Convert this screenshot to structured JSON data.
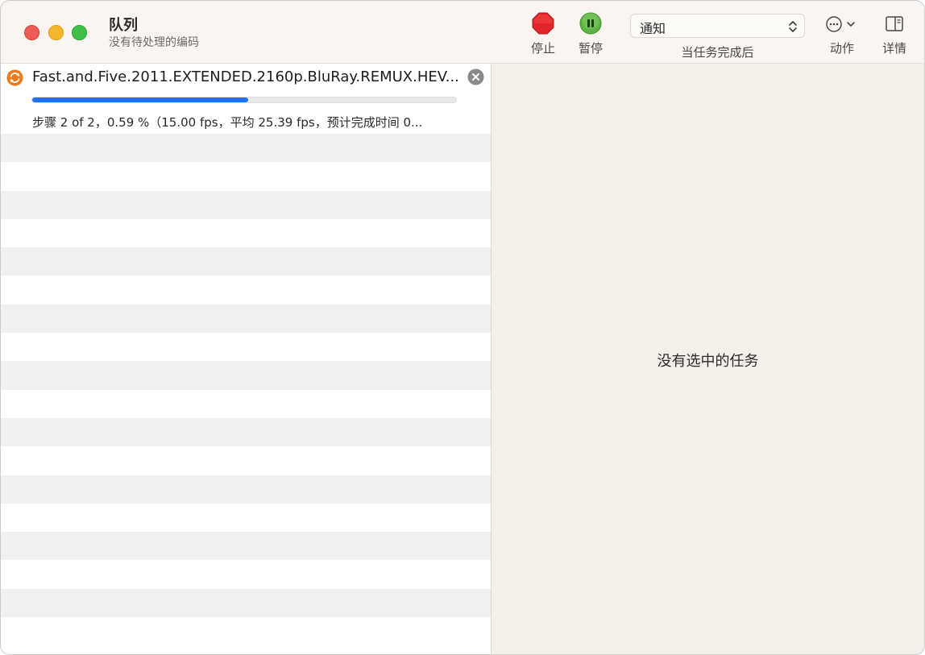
{
  "window": {
    "title": "队列",
    "subtitle": "没有待处理的编码"
  },
  "toolbar": {
    "stop_label": "停止",
    "pause_label": "暂停",
    "notify_value": "通知",
    "notify_caption": "当任务完成后",
    "actions_label": "动作",
    "details_label": "详情"
  },
  "queue": {
    "jobs": [
      {
        "title": "Fast.and.Five.2011.EXTENDED.2160p.BluRay.REMUX.HEV...",
        "detail": "步骤 2 of 2，0.59 %（15.00 fps，平均 25.39 fps，预计完成时间 0...",
        "progress": 0.51
      }
    ]
  },
  "detail_pane": {
    "empty_message": "没有选中的任务"
  },
  "colors": {
    "accent": "#1f6ff0",
    "stop": "#e0262c",
    "pause": "#5fb246",
    "status_orange": "#f07a1b"
  }
}
